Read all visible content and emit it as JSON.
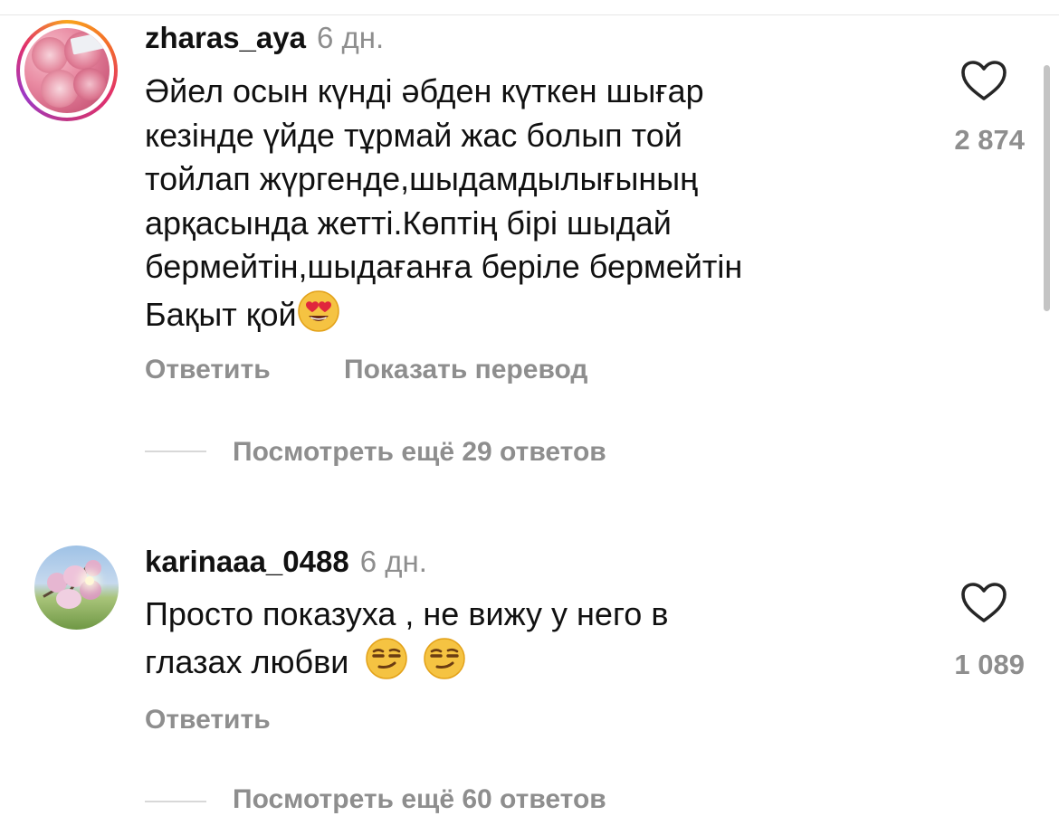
{
  "comments": [
    {
      "username": "zharas_aya",
      "time": "6 дн.",
      "lines": [
        "Әйел осын күнді әбден күткен шығар",
        "кезінде үйде тұрмай жас болып той",
        "тойлап жүргенде,шыдамдылығының",
        "арқасында жетті.Көптің бірі шыдай",
        "бермейтін,шыдағанға беріле бермейтін",
        "Бақыт қой"
      ],
      "emoji_names": [
        "heart-eyes-emoji"
      ],
      "like_count": "2 874",
      "reply_label": "Ответить",
      "translate_label": "Показать перевод",
      "view_replies_label": "Посмотреть ещё 29 ответов"
    },
    {
      "username": "karinaaa_0488",
      "time": "6 дн.",
      "lines": [
        "Просто показуха , не вижу у него в",
        "глазах любви"
      ],
      "emoji_names": [
        "smirking-face-emoji",
        "smirking-face-emoji"
      ],
      "like_count": "1 089",
      "reply_label": "Ответить",
      "view_replies_label": "Посмотреть ещё 60 ответов"
    }
  ],
  "icons": {
    "like": "heart-outline-icon"
  },
  "colors": {
    "text": "#111111",
    "secondary": "#8e8e8e",
    "divider": "#d8d8d8",
    "story_ring_start": "#f9a51b",
    "story_ring_end": "#c13584"
  }
}
